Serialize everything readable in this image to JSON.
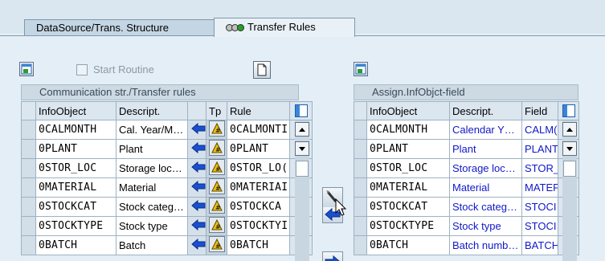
{
  "tabs": [
    {
      "label": "DataSource/Trans. Structure",
      "active": false
    },
    {
      "label": "Transfer Rules",
      "active": true
    }
  ],
  "left": {
    "start_routine_label": "Start Routine",
    "table_title": "Communication str./Transfer rules",
    "columns": [
      "InfoObject",
      "Descript.",
      "Tp",
      "Rule"
    ],
    "rows": [
      {
        "infoobject": "0CALMONTH",
        "descript": "Cal. Year/M…",
        "rule": "0CALMONTI"
      },
      {
        "infoobject": "0PLANT",
        "descript": "Plant",
        "rule": "0PLANT"
      },
      {
        "infoobject": "0STOR_LOC",
        "descript": "Storage loc…",
        "rule": "0STOR_LO("
      },
      {
        "infoobject": "0MATERIAL",
        "descript": "Material",
        "rule": "0MATERIAI"
      },
      {
        "infoobject": "0STOCKCAT",
        "descript": "Stock categ…",
        "rule": "0STOCKCA"
      },
      {
        "infoobject": "0STOCKTYPE",
        "descript": "Stock type",
        "rule": "0STOCKTYI"
      },
      {
        "infoobject": "0BATCH",
        "descript": "Batch",
        "rule": "0BATCH"
      }
    ]
  },
  "right": {
    "table_title": "Assign.InfObjct-field",
    "columns": [
      "InfoObject",
      "Descript.",
      "Field"
    ],
    "rows": [
      {
        "infoobject": "0CALMONTH",
        "descript": "Calendar Y…",
        "field": "CALM("
      },
      {
        "infoobject": "0PLANT",
        "descript": "Plant",
        "field": "PLANT"
      },
      {
        "infoobject": "0STOR_LOC",
        "descript": "Storage loc…",
        "field": "STOR_"
      },
      {
        "infoobject": "0MATERIAL",
        "descript": "Material",
        "field": "MATEF"
      },
      {
        "infoobject": "0STOCKCAT",
        "descript": "Stock categ…",
        "field": "STOCI"
      },
      {
        "infoobject": "0STOCKTYPE",
        "descript": "Stock type",
        "field": "STOCI"
      },
      {
        "infoobject": "0BATCH",
        "descript": "Batch numb…",
        "field": "BATCH"
      }
    ]
  },
  "icons": {
    "tab_status": "traffic-light-icon",
    "arrow_color": "#1a4fd0",
    "tp_icon": "formula-triangle-icon"
  }
}
